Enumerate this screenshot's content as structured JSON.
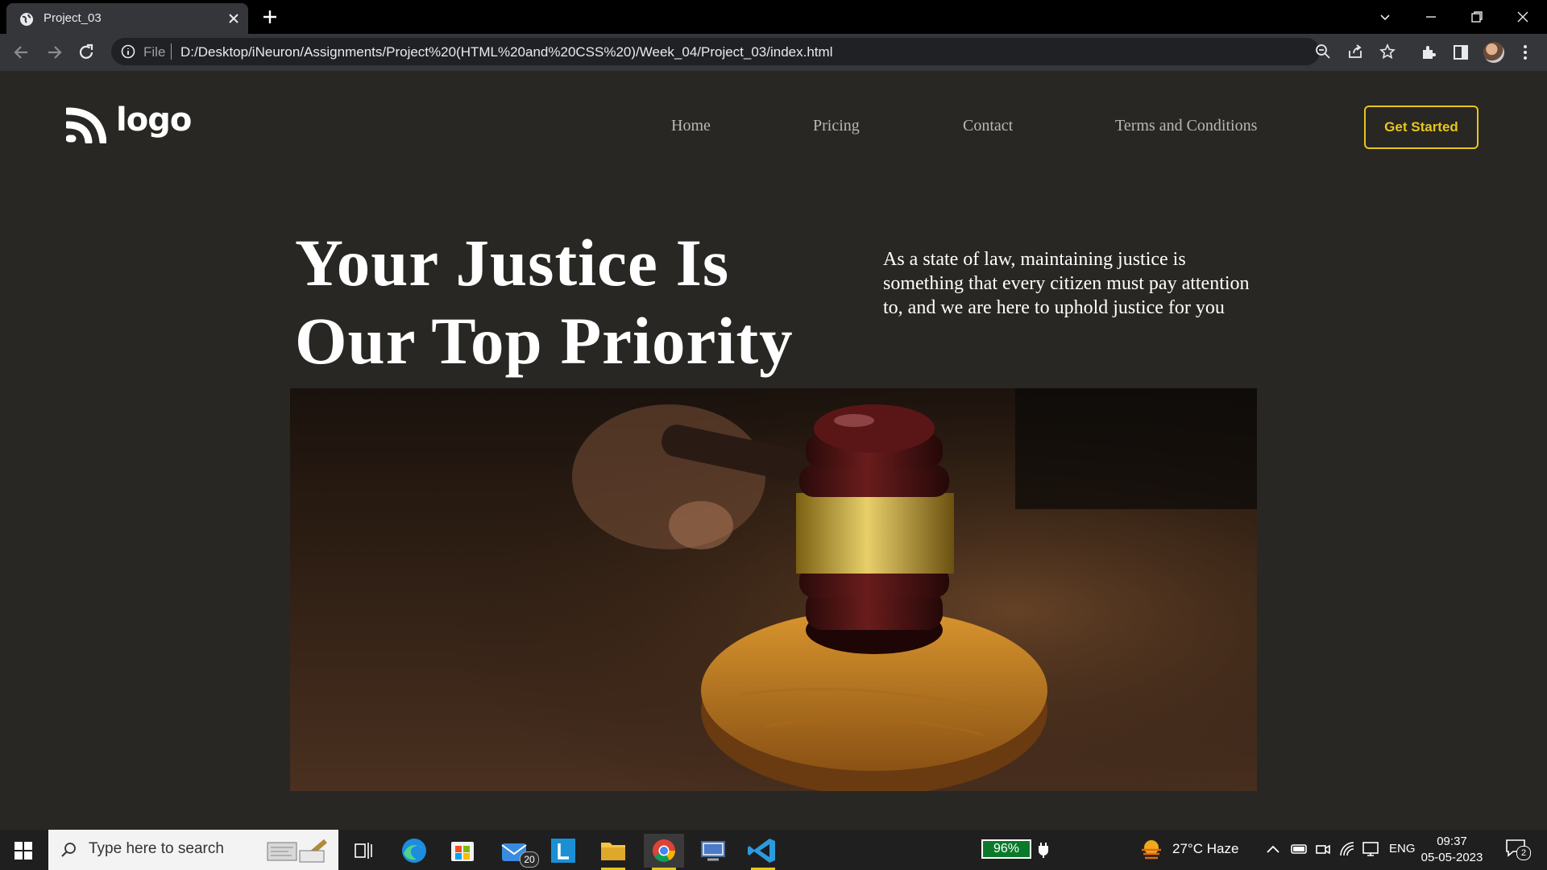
{
  "browser": {
    "tab_title": "Project_03",
    "url_scheme": "File",
    "url": "D:/Desktop/iNeuron/Assignments/Project%20(HTML%20and%20CSS%20)/Week_04/Project_03/index.html"
  },
  "site": {
    "logo_text": "logo",
    "nav": [
      {
        "label": "Home"
      },
      {
        "label": "Pricing"
      },
      {
        "label": "Contact"
      },
      {
        "label": "Terms and Conditions"
      }
    ],
    "cta_label": "Get Started",
    "hero_title_line1": "Your Justice Is",
    "hero_title_line2": "Our Top Priority",
    "hero_text": "As a state of law, maintaining justice is something that every citizen must pay attention to, and we are here to uphold justice for you",
    "accent_color": "#e7c61d",
    "background_color": "#282723"
  },
  "taskbar": {
    "search_placeholder": "Type here to search",
    "mail_badge": "20",
    "battery": "96%",
    "weather": "27°C  Haze",
    "language": "ENG",
    "time": "09:37",
    "date": "05-05-2023",
    "notifications": "2"
  }
}
